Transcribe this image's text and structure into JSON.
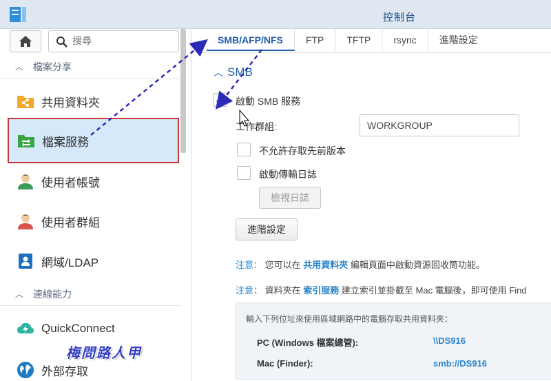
{
  "window": {
    "title": "控制台"
  },
  "sidebar": {
    "search_placeholder": "搜尋",
    "sections": [
      {
        "label": "檔案分享"
      },
      {
        "label": "連線能力"
      }
    ],
    "items": [
      {
        "label": "共用資料夾",
        "icon": "shared-folder-icon"
      },
      {
        "label": "檔案服務",
        "icon": "file-services-icon",
        "selected": true
      },
      {
        "label": "使用者帳號",
        "icon": "user-icon"
      },
      {
        "label": "使用者群組",
        "icon": "user-group-icon"
      },
      {
        "label": "網域/LDAP",
        "icon": "domain-ldap-icon"
      },
      {
        "label": "QuickConnect",
        "icon": "quickconnect-icon"
      },
      {
        "label": "外部存取",
        "icon": "external-access-icon"
      }
    ]
  },
  "tabs": [
    {
      "label": "SMB/AFP/NFS",
      "active": true
    },
    {
      "label": "FTP"
    },
    {
      "label": "TFTP"
    },
    {
      "label": "rsync"
    },
    {
      "label": "進階設定"
    }
  ],
  "smb": {
    "title": "SMB",
    "enable_label": "啟動 SMB 服務",
    "enable_checked": true,
    "workgroup_label": "工作群組:",
    "workgroup_value": "WORKGROUP",
    "disallow_prev_label": "不允許存取先前版本",
    "enable_log_label": "啟動傳輸日誌",
    "view_log_button": "檢視日誌",
    "advanced_button": "進階設定"
  },
  "notes": [
    {
      "label": "注意：",
      "pre": "您可以在 ",
      "link": "共用資料夾",
      "post": " 編輯頁面中啟動資源回收筒功能。"
    },
    {
      "label": "注意：",
      "pre": "資料夾在 ",
      "link": "索引服務",
      "post": " 建立索引並掛載至 Mac 電腦後，即可使用 Find"
    }
  ],
  "info": {
    "heading": "輸入下列位址來使用區域網路中的電腦存取共用資料夾：",
    "rows": [
      {
        "label": "PC (Windows 檔案總管):",
        "value": "\\\\DS916"
      },
      {
        "label": "Mac (Finder):",
        "value": "smb://DS916"
      }
    ]
  },
  "watermark": "梅問路人甲",
  "colors": {
    "accent": "#1d5fa8",
    "link": "#2a84c9",
    "highlight_border": "#c8363a",
    "selected_bg": "#d6e9fb"
  }
}
